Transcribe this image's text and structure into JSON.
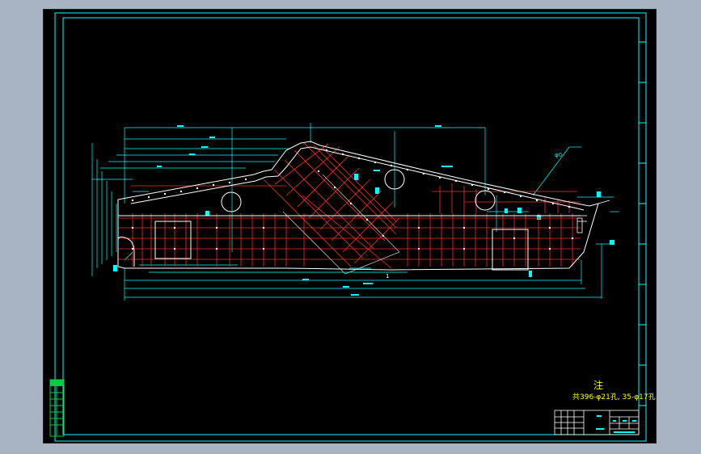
{
  "drawing": {
    "note_title": "注",
    "note_body": "共396-φ21孔, 35-φ17孔",
    "callout_label": "φ0",
    "scale_marker": "1"
  },
  "colors": {
    "background_desktop": "#a9b4c2",
    "canvas": "#000000",
    "frame": "#00ffff",
    "outline": "#ffffff",
    "grid": "#ff2a2a",
    "note": "#ffff00",
    "titleblock_green": "#00cc44"
  }
}
